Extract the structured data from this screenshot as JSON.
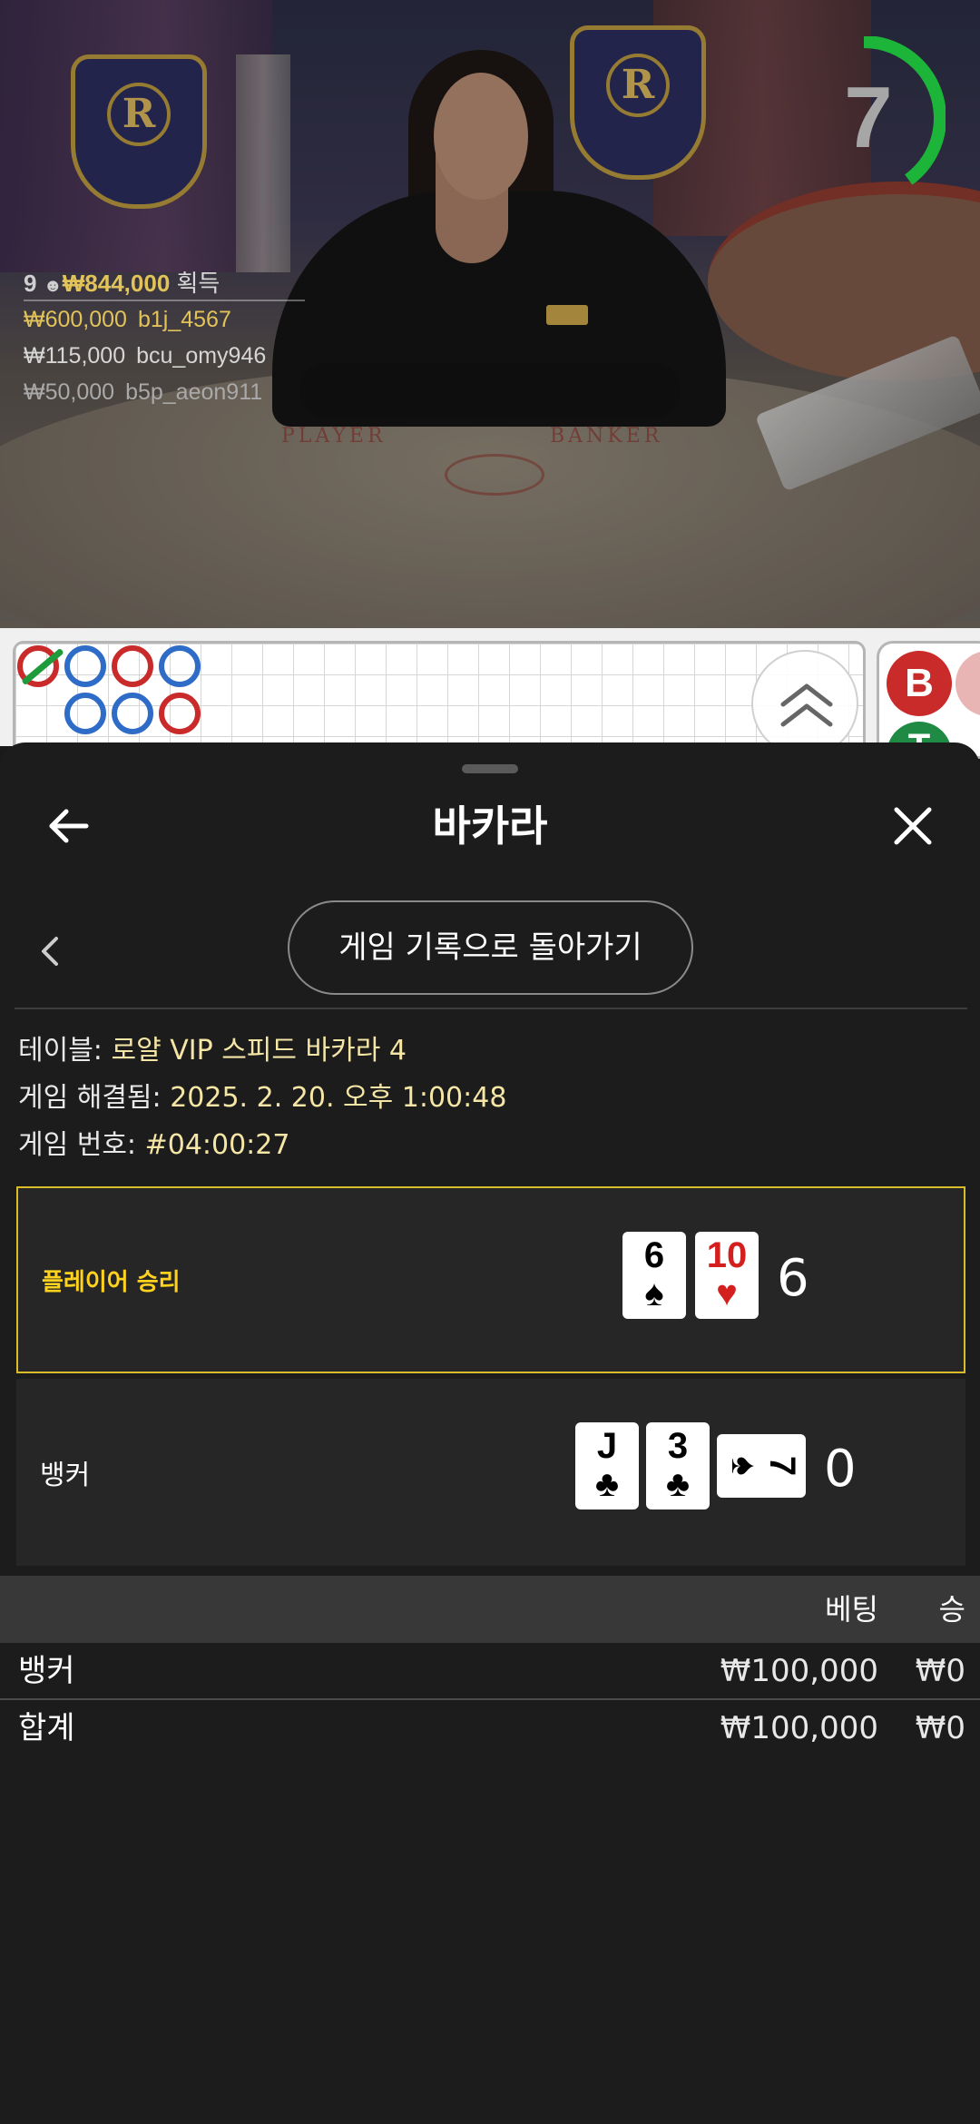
{
  "video": {
    "countdown": "7",
    "countdown_progress": 0.4,
    "felt_labels": {
      "player": "PLAYER",
      "banker": "BANKER"
    },
    "winners_summary": {
      "count": "9",
      "total": "₩844,000",
      "label": "획득"
    },
    "winners": [
      {
        "amount": "₩600,000",
        "user": "b1j_4567",
        "color": "#e2c35a"
      },
      {
        "amount": "₩115,000",
        "user": "bcu_omy946",
        "color": "#d6d6d6"
      },
      {
        "amount": "₩50,000",
        "user": "b5p_aeon911",
        "color": "#a9a9a9"
      }
    ]
  },
  "roadmap": {
    "chip_banker": "B",
    "chip_tie": "T"
  },
  "sheet": {
    "title": "바카라",
    "history_button": "게임 기록으로 돌아가기",
    "info": {
      "table_label": "테이블:",
      "table_value": "로얄 VIP 스피드 바카라 4",
      "settled_label": "게임 해결됨:",
      "settled_value": "2025. 2. 20. 오후 1:00:48",
      "round_label": "게임 번호:",
      "round_value": "#04:00:27"
    },
    "player_hand": {
      "label": "플레이어 승리",
      "score": "6",
      "cards": [
        {
          "rank": "6",
          "suit": "♠",
          "color": "black"
        },
        {
          "rank": "10",
          "suit": "♥",
          "color": "red"
        }
      ]
    },
    "banker_hand": {
      "label": "뱅커",
      "score": "0",
      "cards": [
        {
          "rank": "J",
          "suit": "♣",
          "color": "black"
        },
        {
          "rank": "3",
          "suit": "♣",
          "color": "black"
        },
        {
          "rank": "7",
          "suit": "♠",
          "color": "black",
          "sideways": true
        }
      ]
    },
    "bets": {
      "col_bet": "베팅",
      "col_win": "승",
      "rows": [
        {
          "name": "뱅커",
          "bet": "₩100,000",
          "win": "₩0"
        }
      ],
      "total": {
        "name": "합계",
        "bet": "₩100,000",
        "win": "₩0"
      }
    }
  },
  "colors": {
    "accent_gold": "#d8bc2a",
    "player_win_text": "#ffd21e",
    "timer_green": "#1db43a",
    "banker_red": "#c92a2a",
    "player_blue": "#2e6cc7",
    "tie_green": "#1e8a44"
  },
  "icons": {
    "back": "arrow-left-icon",
    "close": "close-icon",
    "prev": "chevron-left-icon",
    "expand": "double-chevron-up-icon"
  }
}
